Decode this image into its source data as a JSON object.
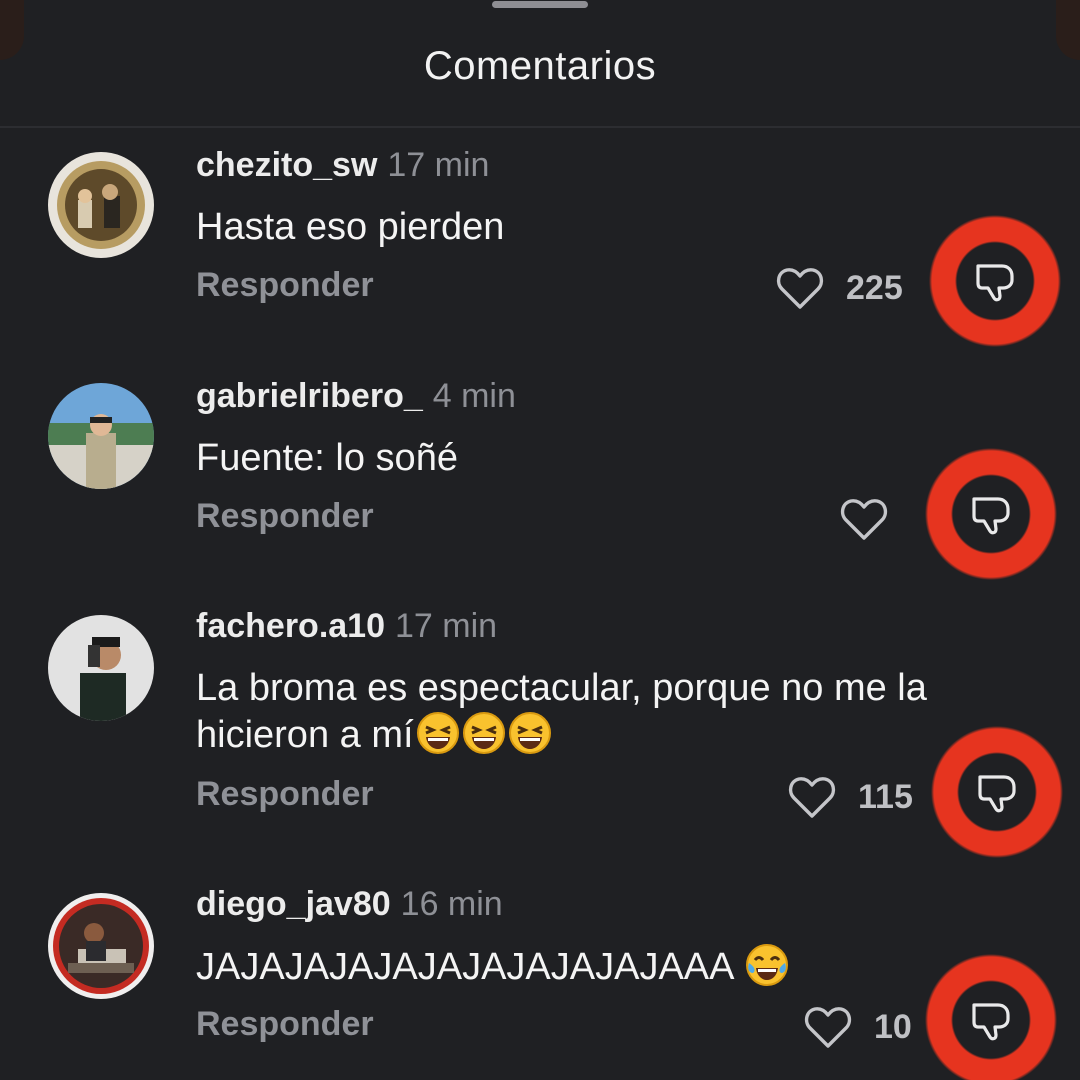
{
  "header": {
    "title": "Comentarios"
  },
  "comments": [
    {
      "username": "chezito_sw",
      "time": "17 min",
      "text": "Hasta eso pierden",
      "reply_label": "Responder",
      "likes": "225"
    },
    {
      "username": "gabrielribero_",
      "time": "4 min",
      "text": "Fuente: lo soñé",
      "reply_label": "Responder",
      "likes": ""
    },
    {
      "username": "fachero.a10",
      "time": "17 min",
      "text_line1": "La broma es espectacular, porque no me la",
      "text_line2": "hicieron a mí",
      "emojis": [
        "laughing-emoji",
        "laughing-emoji",
        "laughing-emoji"
      ],
      "reply_label": "Responder",
      "likes": "115"
    },
    {
      "username": "diego_jav80",
      "time": "16 min",
      "text": "JAJAJAJAJAJAJAJAJAJAJAAA",
      "emojis": [
        "tears-of-joy-emoji"
      ],
      "reply_label": "Responder",
      "likes": "10"
    }
  ],
  "icons": {
    "like": "heart-outline-icon",
    "dislike": "thumbs-down-icon"
  },
  "colors": {
    "background": "#1f2023",
    "highlight_ring": "#e6341f",
    "secondary_text": "#8f9197"
  }
}
